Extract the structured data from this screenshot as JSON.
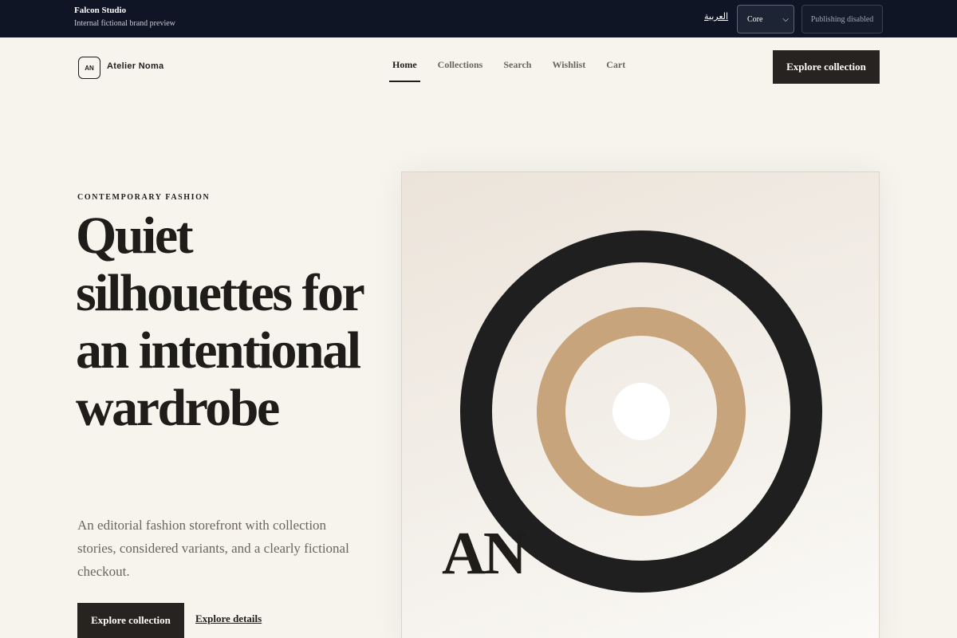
{
  "topbar": {
    "studio_name": "Falcon Studio",
    "studio_sub": "Internal fictional brand preview",
    "language_link": "العربية",
    "theme_select": "Core",
    "publish_button": "Publishing disabled"
  },
  "nav": {
    "logo_badge": "AN",
    "brand": "Atelier Noma",
    "items": [
      {
        "label": "Home",
        "active": true
      },
      {
        "label": "Collections",
        "active": false
      },
      {
        "label": "Search",
        "active": false
      },
      {
        "label": "Wishlist",
        "active": false
      },
      {
        "label": "Cart",
        "active": false
      }
    ],
    "cta": "Explore collection"
  },
  "hero": {
    "eyebrow": "CONTEMPORARY FASHION",
    "headline": "Quiet silhouettes for an intentional wardrobe",
    "lede": "An editorial fashion storefront with collection stories, considered variants, and a clearly fictional checkout.",
    "primary_cta": "Explore collection",
    "secondary_link": "Explore details",
    "art_monogram": "AN"
  },
  "colors": {
    "topbar_bg": "#0f1524",
    "page_bg": "#f7f4ee",
    "ink": "#1f1f1f",
    "accent_tan": "#c8a47c"
  }
}
